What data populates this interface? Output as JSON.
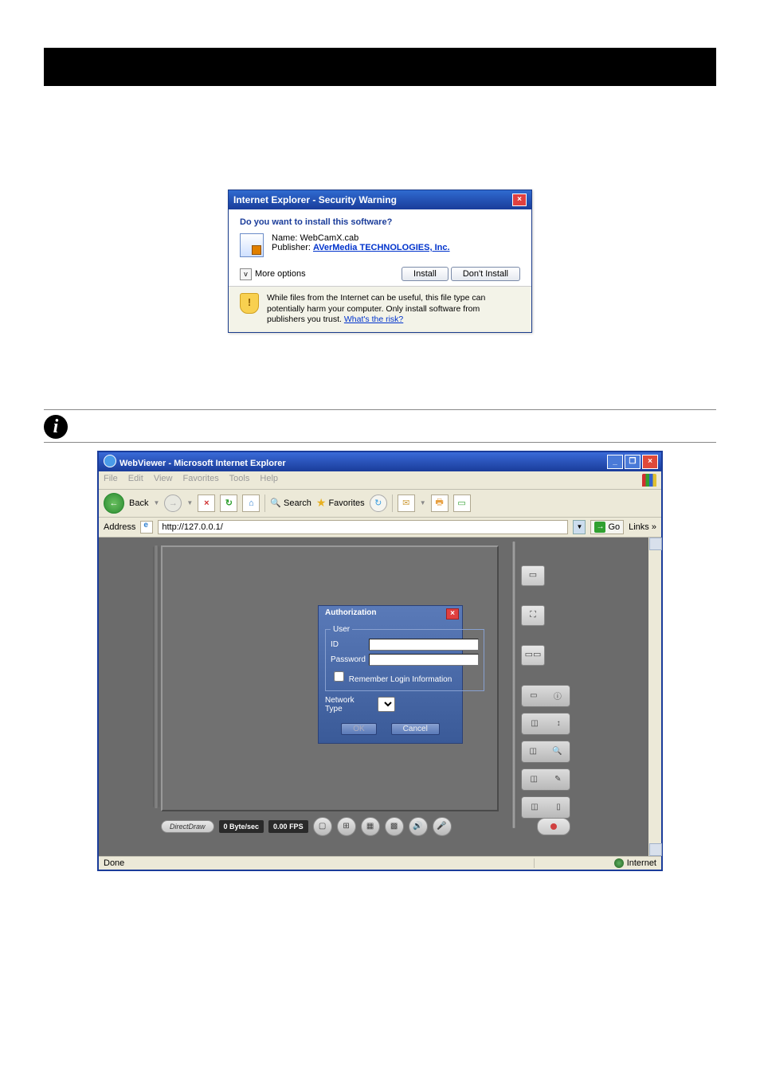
{
  "dialog": {
    "title": "Internet Explorer - Security Warning",
    "question": "Do you want to install this software?",
    "name_label": "Name:",
    "name_value": "WebCamX.cab",
    "publisher_label": "Publisher:",
    "publisher_value": "AVerMedia TECHNOLOGIES, Inc.",
    "more_options": "More options",
    "install": "Install",
    "dont_install": "Don't Install",
    "warn": "While files from the Internet can be useful, this file type can potentially harm your computer. Only install software from publishers you trust. ",
    "risk_link": "What's the risk?"
  },
  "browser": {
    "title": "WebViewer - Microsoft Internet Explorer",
    "menu": [
      "File",
      "Edit",
      "View",
      "Favorites",
      "Tools",
      "Help"
    ],
    "back": "Back",
    "search": "Search",
    "favorites": "Favorites",
    "address_label": "Address",
    "address_value": "http://127.0.0.1/",
    "go": "Go",
    "links": "Links",
    "status_done": "Done",
    "status_zone": "Internet"
  },
  "auth": {
    "title": "Authorization",
    "legend": "User",
    "id": "ID",
    "password": "Password",
    "remember": "Remember Login Information",
    "nettype": "Network Type",
    "ok": "OK",
    "cancel": "Cancel"
  },
  "bottombar": {
    "mode": "DirectDraw",
    "bitrate": "0 Byte/sec",
    "fps": "0.00 FPS"
  }
}
